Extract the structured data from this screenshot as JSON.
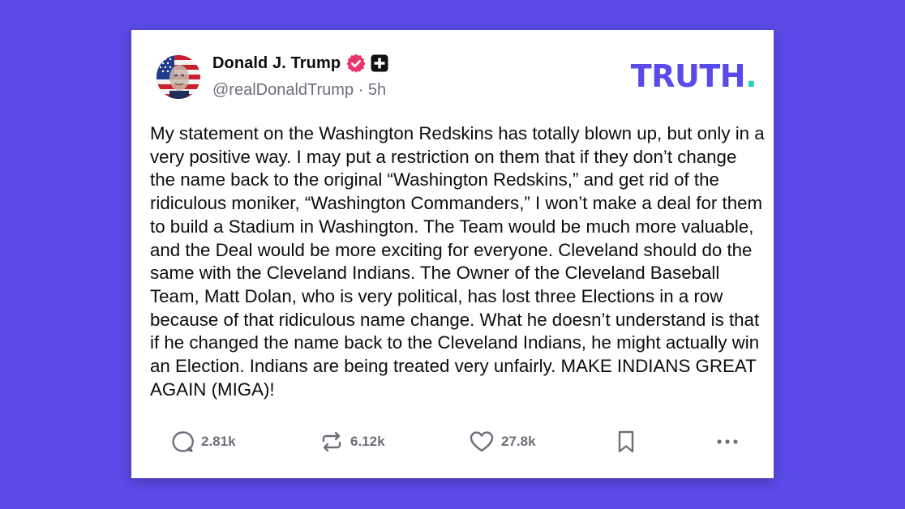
{
  "author": {
    "display_name": "Donald J. Trump",
    "handle": "@realDonaldTrump",
    "separator": "·",
    "time_ago": "5h"
  },
  "brand": {
    "logo_text": "TRUTH",
    "logo_dot": ".",
    "colors": {
      "background": "#5a4ae8",
      "logo": "#5a4ae8",
      "logo_dot": "#1fd4b8",
      "verified_badge": "#e8356a"
    }
  },
  "post": {
    "text": "My statement on the Washington Redskins has totally blown up, but only in a very positive way. I may put a restriction on them that if they don’t change the name back to the original “Washington Redskins,” and get rid of the ridiculous moniker, “Washington Commanders,” I won’t make a deal for them to build a Stadium in Washington. The Team would be much more valuable, and the Deal would be more exciting for everyone. Cleveland should do the same with the Cleveland Indians. The Owner of the Cleveland Baseball Team, Matt Dolan, who is very political, has lost three Elections in a row because of that ridiculous name change. What he doesn’t understand is that if he changed the name back to the Cleveland Indians, he might actually win an Election. Indians are being treated very unfairly. MAKE INDIANS GREAT AGAIN (MIGA)!"
  },
  "actions": {
    "reply": {
      "icon": "reply-icon",
      "count": "2.81k"
    },
    "repost": {
      "icon": "repost-icon",
      "count": "6.12k"
    },
    "like": {
      "icon": "heart-icon",
      "count": "27.8k"
    },
    "bookmark": {
      "icon": "bookmark-icon"
    },
    "more": {
      "icon": "more-icon"
    }
  }
}
